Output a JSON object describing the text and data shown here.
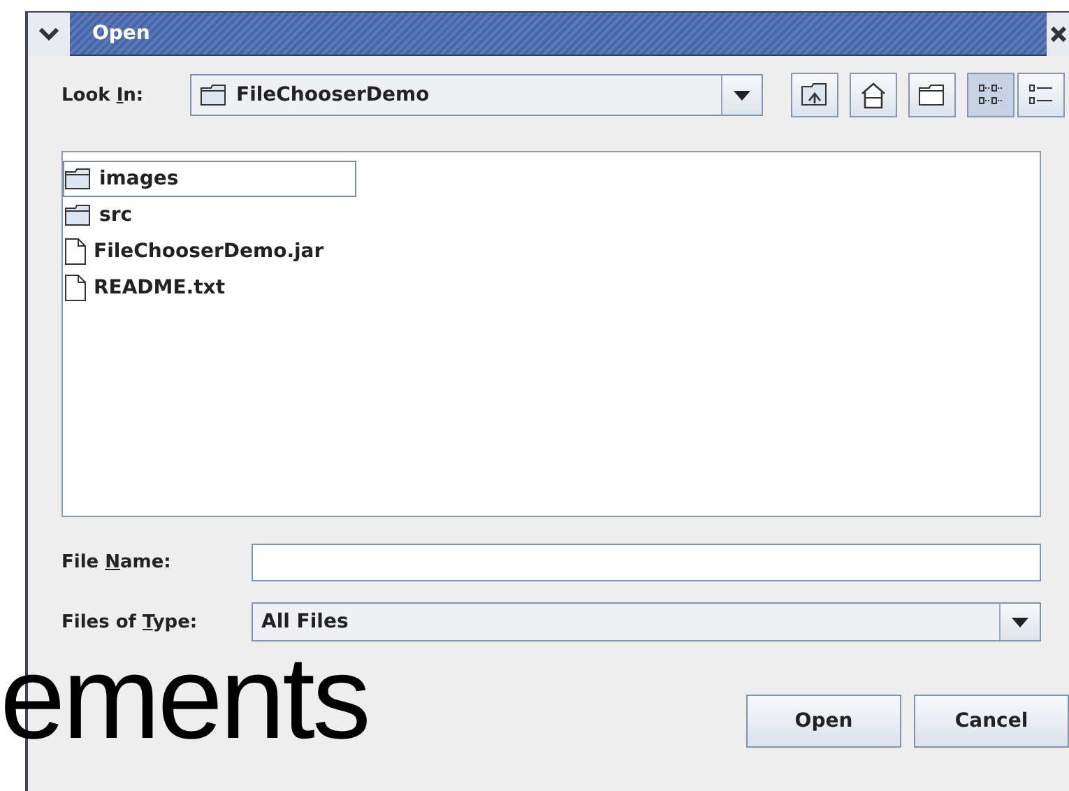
{
  "window": {
    "title": "Open"
  },
  "look_in": {
    "label": [
      {
        "text": "Look ",
        "underlined": false
      },
      {
        "text": "I",
        "underlined": true
      },
      {
        "text": "n:",
        "underlined": false
      }
    ],
    "value": "FileChooserDemo"
  },
  "toolbar": [
    {
      "kind": "up",
      "selected": false
    },
    {
      "kind": "home",
      "selected": false
    },
    {
      "kind": "new-folder",
      "selected": false
    },
    {
      "kind": "list",
      "selected": true
    },
    {
      "kind": "details",
      "selected": false
    }
  ],
  "files": [
    {
      "name": "images",
      "kind": "folder",
      "selected": true
    },
    {
      "name": "src",
      "kind": "folder",
      "selected": false
    },
    {
      "name": "FileChooserDemo.jar",
      "kind": "file",
      "selected": false
    },
    {
      "name": "README.txt",
      "kind": "file",
      "selected": false
    }
  ],
  "file_name": {
    "label": [
      {
        "text": "File ",
        "underlined": false
      },
      {
        "text": "N",
        "underlined": true
      },
      {
        "text": "ame:",
        "underlined": false
      }
    ]
  },
  "files_of_type": {
    "label": [
      {
        "text": "Files of ",
        "underlined": false
      },
      {
        "text": "T",
        "underlined": true
      },
      {
        "text": "ype:",
        "underlined": false
      }
    ],
    "value": "All Files"
  },
  "buttons": [
    "Open",
    "Cancel"
  ],
  "overlay_text": "ements"
}
